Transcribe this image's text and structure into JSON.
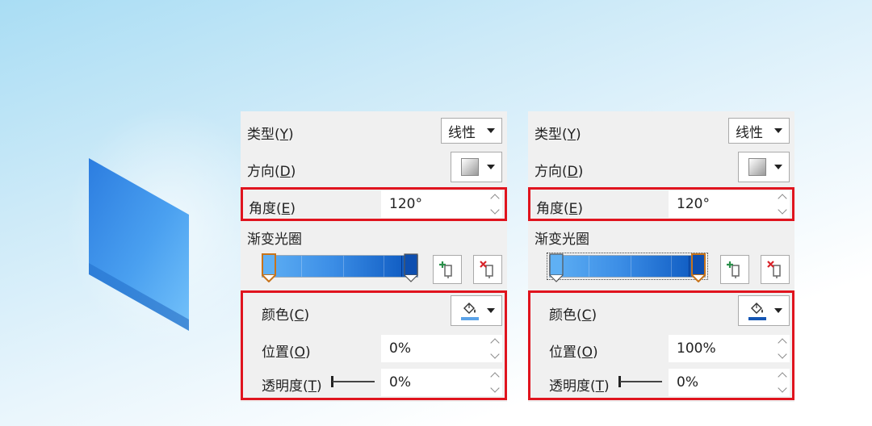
{
  "panels": [
    {
      "type_label": "类型(",
      "type_key": "Y",
      "type_close": ")",
      "type_value": "线性",
      "direction_label": "方向(",
      "direction_key": "D",
      "direction_close": ")",
      "angle_label": "角度(",
      "angle_key": "E",
      "angle_close": ")",
      "angle_value": "120°",
      "stops_label": "渐变光圈",
      "color_label": "颜色(",
      "color_key": "C",
      "color_close": ")",
      "position_label": "位置(",
      "position_key": "O",
      "position_close": ")",
      "position_value": "0%",
      "transparency_label": "透明度(",
      "transparency_key": "T",
      "transparency_close": ")",
      "transparency_value": "0%",
      "color_swatch": "#5ba3e8",
      "selected_stop": "left"
    },
    {
      "type_label": "类型(",
      "type_key": "Y",
      "type_close": ")",
      "type_value": "线性",
      "direction_label": "方向(",
      "direction_key": "D",
      "direction_close": ")",
      "angle_label": "角度(",
      "angle_key": "E",
      "angle_close": ")",
      "angle_value": "120°",
      "stops_label": "渐变光圈",
      "color_label": "颜色(",
      "color_key": "C",
      "color_close": ")",
      "position_label": "位置(",
      "position_key": "O",
      "position_close": ")",
      "position_value": "100%",
      "transparency_label": "透明度(",
      "transparency_key": "T",
      "transparency_close": ")",
      "transparency_value": "0%",
      "color_swatch": "#1456b4",
      "selected_stop": "right"
    }
  ],
  "colors": {
    "highlight_border": "#e0141e",
    "panel_bg": "#f0f0f0",
    "gradient_light": "#5fb0f4",
    "gradient_dark": "#0e4fb0"
  },
  "icons": [
    "dropdown-caret-icon",
    "gradient-direction-icon",
    "add-stop-icon",
    "remove-stop-icon",
    "paint-bucket-icon",
    "spin-up-icon",
    "spin-down-icon"
  ]
}
